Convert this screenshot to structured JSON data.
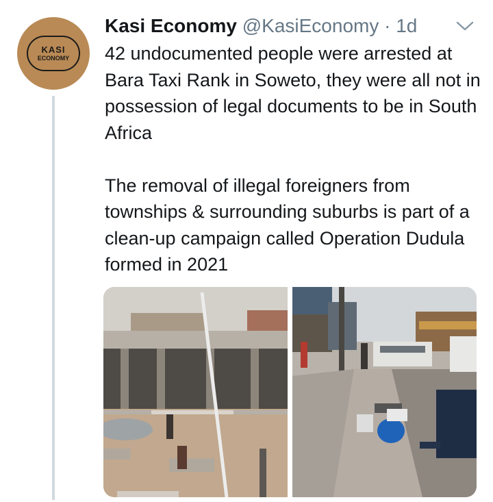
{
  "tweet": {
    "author_name": "Kasi Economy",
    "handle": "@KasiEconomy",
    "separator": "·",
    "time": "1d",
    "avatar": {
      "line1": "KASI",
      "line2": "ECONOMY",
      "color": "#b98a55"
    },
    "paragraphs": [
      "42 undocumented people were arrested at Bara Taxi Rank in Soweto, they were all not in possession of legal documents to be in South Africa",
      "The removal of illegal foreigners from townships & surrounding suburbs is part of a clean-up campaign called Operation Dudula formed in 2021"
    ],
    "menu_icon": "chevron-down-icon",
    "media": [
      {
        "name": "taxi-rank-photo"
      },
      {
        "name": "street-photo"
      }
    ]
  },
  "colors": {
    "text": "#14171a",
    "secondary": "#657786",
    "thread_line": "#cfd9de"
  }
}
